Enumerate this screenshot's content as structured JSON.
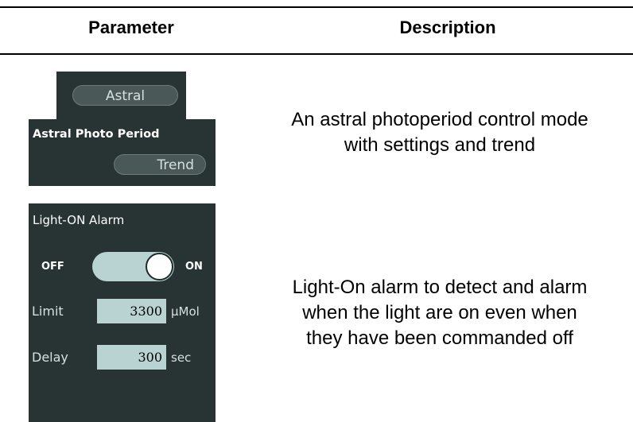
{
  "table": {
    "headers": {
      "parameter": "Parameter",
      "description": "Description"
    }
  },
  "astral": {
    "mode_button": "Astral",
    "title": "Astral Photo Period",
    "trend_button": "Trend",
    "description_line1": "An astral photoperiod control mode",
    "description_line2": "with settings and trend"
  },
  "alarm": {
    "title": "Light-ON Alarm",
    "toggle": {
      "off_label": "OFF",
      "on_label": "ON",
      "state": "on"
    },
    "limit": {
      "label": "Limit",
      "value": "3300",
      "unit": "μMol"
    },
    "delay": {
      "label": "Delay",
      "value": "300",
      "unit": "sec"
    },
    "description_line1": "Light-On alarm to detect and alarm",
    "description_line2": "when the light are on even when",
    "description_line3": "they have been commanded off"
  },
  "colors": {
    "panel_bg": "#273433",
    "field_bg": "#b9d2d2",
    "pill_bg": "#4a5857"
  }
}
